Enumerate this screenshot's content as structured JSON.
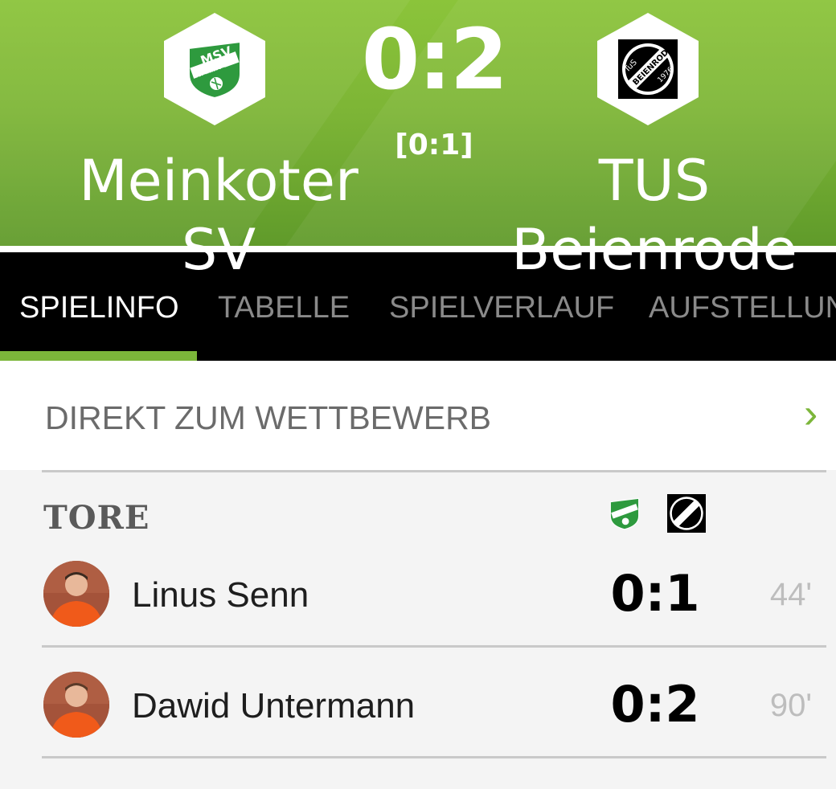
{
  "match": {
    "home_team": "Meinkoter SV",
    "away_team": "TUS Beienrode",
    "score": "0:2",
    "halftime": "[0:1]",
    "home_logo_text": "MSV",
    "home_logo_subtext": "MEINKOT",
    "away_logo_text": "TuS",
    "away_logo_subtext": "BEIENRODE",
    "away_logo_year": "1976"
  },
  "tabs": [
    {
      "label": "SPIELINFO",
      "active": true
    },
    {
      "label": "TABELLE",
      "active": false
    },
    {
      "label": "SPIELVERLAUF",
      "active": false
    },
    {
      "label": "AUFSTELLUN",
      "active": false
    }
  ],
  "direct_link": {
    "label": "DIREKT ZUM WETTBEWERB",
    "icon": "chevron-right-icon"
  },
  "goals_section": {
    "title": "TORE",
    "goals": [
      {
        "player": "Linus Senn",
        "score": "0:1",
        "minute": "44'"
      },
      {
        "player": "Dawid Untermann",
        "score": "0:2",
        "minute": "90'"
      }
    ]
  },
  "colors": {
    "brand_green": "#7cb63a",
    "header_green": "#8bc43a",
    "tab_bar": "#000000",
    "inactive_tab": "#8a8a8a",
    "minute_gray": "#bdbdbd"
  }
}
